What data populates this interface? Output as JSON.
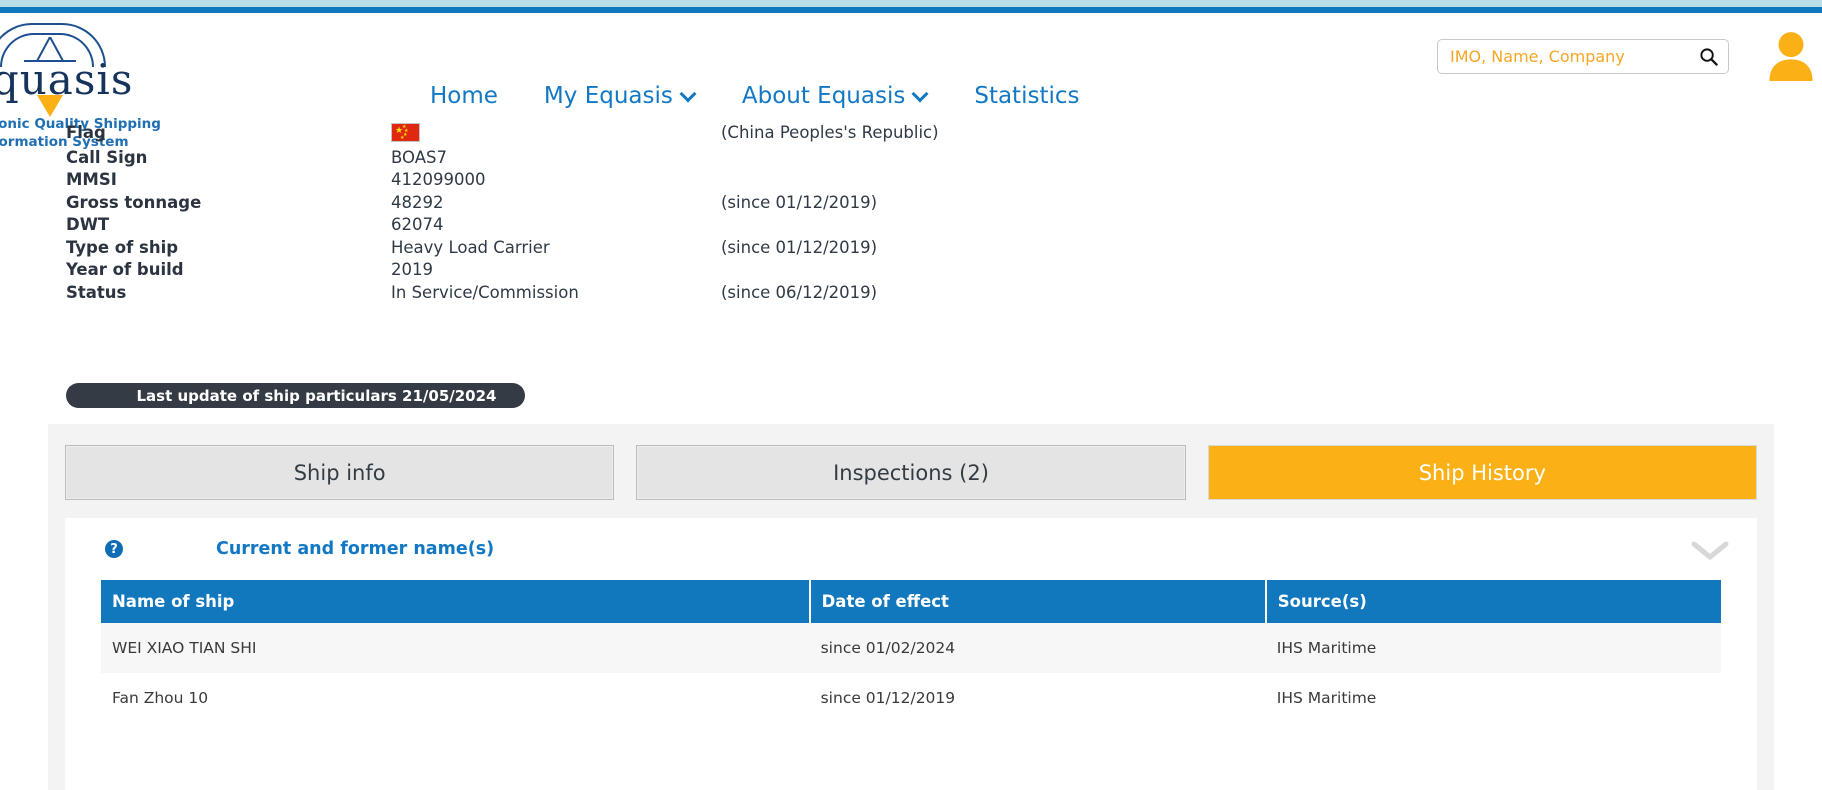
{
  "colors": {
    "brand_blue": "#1378c4",
    "accent_orange": "#fbb116",
    "table_header_blue": "#1178be",
    "dark_pill": "#343b45"
  },
  "topbar": {
    "light_band": "#b9dee8",
    "blue_band": "#0f77bd"
  },
  "logo": {
    "wordmark": "equasis",
    "tagline_line1": "Electronic Quality Shipping",
    "tagline_line2": "Information System"
  },
  "nav": {
    "items": [
      {
        "label": "Home",
        "has_caret": false,
        "icon": ""
      },
      {
        "label": "My Equasis",
        "has_caret": true,
        "icon": "chevron-down-icon"
      },
      {
        "label": "About Equasis",
        "has_caret": true,
        "icon": "chevron-down-icon"
      },
      {
        "label": "Statistics",
        "has_caret": false,
        "icon": ""
      }
    ]
  },
  "search": {
    "placeholder": "IMO, Name, Company",
    "value": "",
    "icon": "search-icon"
  },
  "account": {
    "icon": "user-avatar-icon"
  },
  "particulars": {
    "rows": [
      {
        "label": "Flag",
        "value": "",
        "note": "(China Peoples's Republic)",
        "type": "flag",
        "flag_alt": "China flag"
      },
      {
        "label": "Call Sign",
        "value": "BOAS7",
        "note": "",
        "type": "text"
      },
      {
        "label": "MMSI",
        "value": "412099000",
        "note": "",
        "type": "text"
      },
      {
        "label": "Gross tonnage",
        "value": "48292",
        "note": "(since 01/12/2019)",
        "type": "text"
      },
      {
        "label": "DWT",
        "value": "62074",
        "note": "",
        "type": "text"
      },
      {
        "label": "Type of ship",
        "value": "Heavy Load Carrier",
        "note": "(since 01/12/2019)",
        "type": "text"
      },
      {
        "label": "Year of build",
        "value": "2019",
        "note": "",
        "type": "text"
      },
      {
        "label": "Status",
        "value": "In Service/Commission",
        "note": "(since 06/12/2019)",
        "type": "text"
      }
    ],
    "last_update": "Last update of ship particulars 21/05/2024"
  },
  "tabs": [
    {
      "label": "Ship info",
      "active": false
    },
    {
      "label": "Inspections (2)",
      "active": false
    },
    {
      "label": "Ship History",
      "active": true
    }
  ],
  "section": {
    "help_icon_glyph": "?",
    "title": "Current and former name(s)",
    "collapse_icon": "chevron-down-icon"
  },
  "table": {
    "columns": [
      "Name of ship",
      "Date of effect",
      "Source(s)"
    ],
    "rows": [
      [
        "WEI XIAO TIAN SHI",
        "since 01/02/2024",
        "IHS Maritime"
      ],
      [
        "Fan Zhou 10",
        "since 01/12/2019",
        "IHS Maritime"
      ]
    ]
  }
}
